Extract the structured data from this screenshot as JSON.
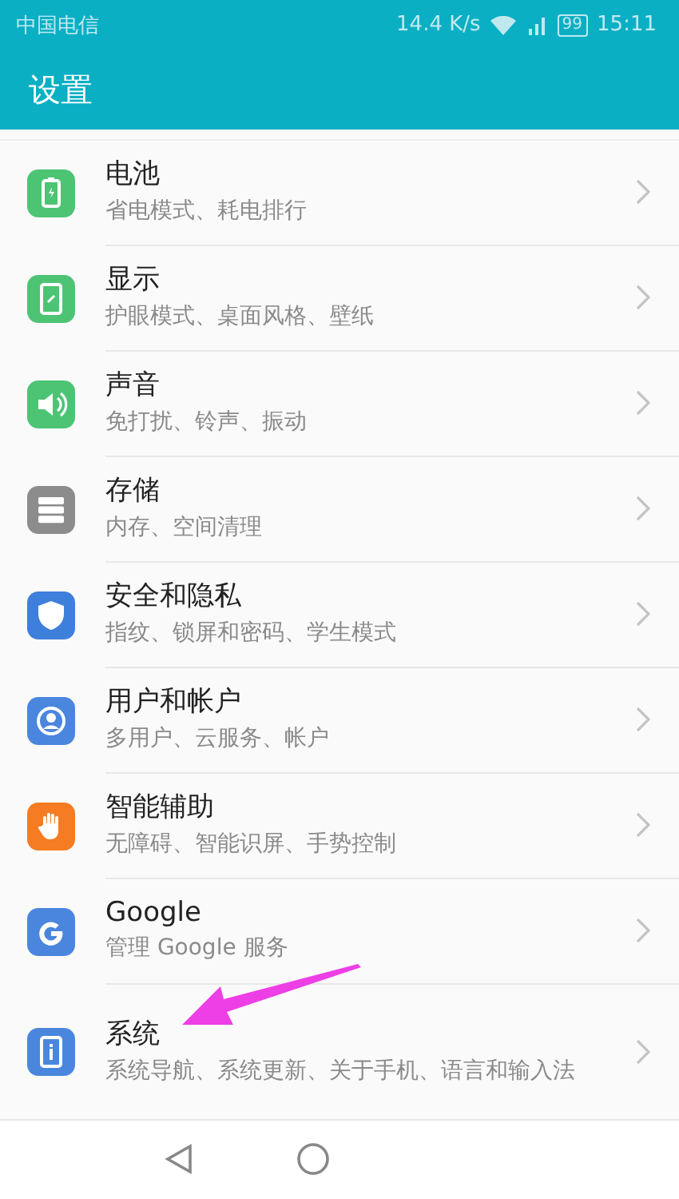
{
  "status_bar": {
    "carrier": "中国电信",
    "speed": "14.4 K/s",
    "battery": "99",
    "time": "15:11"
  },
  "header": {
    "title": "设置"
  },
  "items": [
    {
      "title": "电池",
      "subtitle": "省电模式、耗电排行",
      "color": "#4cc474"
    },
    {
      "title": "显示",
      "subtitle": "护眼模式、桌面风格、壁纸",
      "color": "#4cc474"
    },
    {
      "title": "声音",
      "subtitle": "免打扰、铃声、振动",
      "color": "#4cc474"
    },
    {
      "title": "存储",
      "subtitle": "内存、空间清理",
      "color": "#8c8c8c"
    },
    {
      "title": "安全和隐私",
      "subtitle": "指纹、锁屏和密码、学生模式",
      "color": "#3e7fdc"
    },
    {
      "title": "用户和帐户",
      "subtitle": "多用户、云服务、帐户",
      "color": "#4a86de"
    },
    {
      "title": "智能辅助",
      "subtitle": "无障碍、智能识屏、手势控制",
      "color": "#f57c22"
    },
    {
      "title": "Google",
      "subtitle": "管理 Google 服务",
      "color": "#4a86de"
    },
    {
      "title": "系统",
      "subtitle": "系统导航、系统更新、关于手机、语言和输入法",
      "color": "#4a86de"
    }
  ]
}
